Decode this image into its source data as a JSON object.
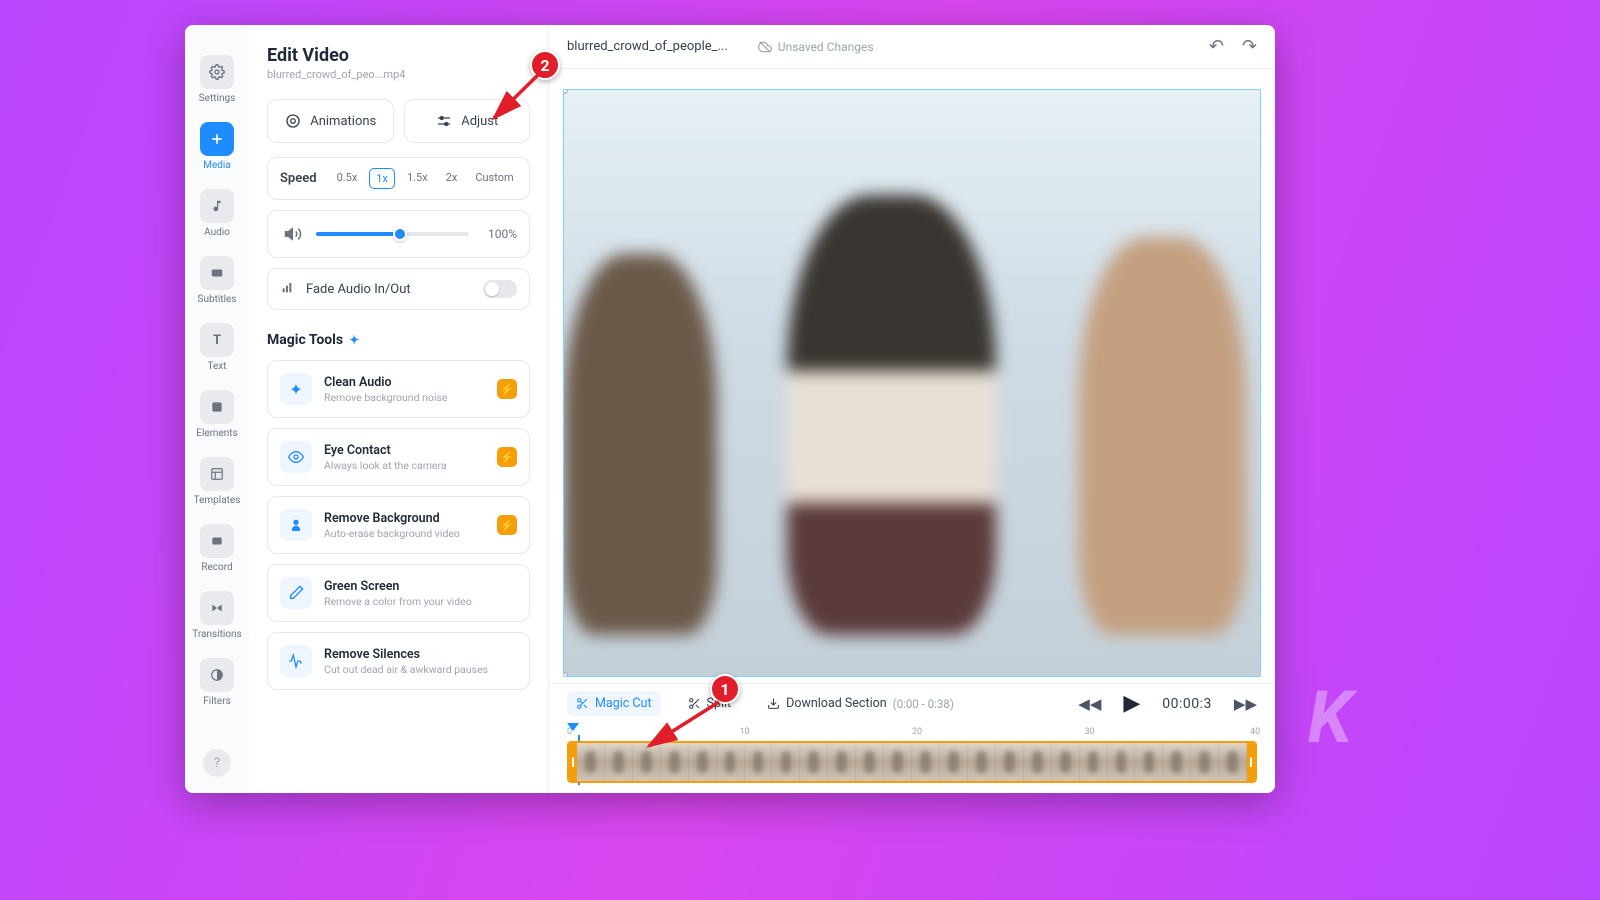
{
  "watermark": "K",
  "nav": {
    "items": [
      {
        "label": "Settings",
        "icon": "gear"
      },
      {
        "label": "Media",
        "icon": "plus",
        "active": true
      },
      {
        "label": "Audio",
        "icon": "audio"
      },
      {
        "label": "Subtitles",
        "icon": "subtitles"
      },
      {
        "label": "Text",
        "icon": "text"
      },
      {
        "label": "Elements",
        "icon": "elements"
      },
      {
        "label": "Templates",
        "icon": "templates"
      },
      {
        "label": "Record",
        "icon": "record"
      },
      {
        "label": "Transitions",
        "icon": "transitions"
      },
      {
        "label": "Filters",
        "icon": "filters"
      }
    ],
    "help": "?"
  },
  "panel": {
    "title": "Edit Video",
    "subtitle": "blurred_crowd_of_peo...mp4",
    "tabs": {
      "animations": "Animations",
      "adjust": "Adjust"
    },
    "speed": {
      "label": "Speed",
      "options": [
        "0.5x",
        "1x",
        "1.5x",
        "2x",
        "Custom"
      ],
      "selected": "1x"
    },
    "volume": {
      "value": "100%"
    },
    "fade": {
      "label": "Fade Audio In/Out"
    },
    "magic": {
      "title": "Magic Tools",
      "tools": [
        {
          "name": "Clean Audio",
          "desc": "Remove background noise",
          "icon": "sparkle",
          "bolt": true
        },
        {
          "name": "Eye Contact",
          "desc": "Always look at the camera",
          "icon": "eye",
          "bolt": true
        },
        {
          "name": "Remove Background",
          "desc": "Auto-erase background video",
          "icon": "person",
          "bolt": true
        },
        {
          "name": "Green Screen",
          "desc": "Remove a color from your video",
          "icon": "dropper",
          "bolt": false
        },
        {
          "name": "Remove Silences",
          "desc": "Cut out dead air & awkward pauses",
          "icon": "wave",
          "bolt": false
        }
      ]
    }
  },
  "topbar": {
    "filename": "blurred_crowd_of_people_...",
    "unsaved": "Unsaved Changes"
  },
  "controls": {
    "magic_cut": "Magic Cut",
    "split": "Split",
    "download": "Download Section",
    "range": "(0:00 - 0:38)",
    "timecode": "00:00:3"
  },
  "ruler": [
    "0",
    "10",
    "20",
    "30",
    "40"
  ],
  "annotations": {
    "badge1": "1",
    "badge2": "2"
  }
}
